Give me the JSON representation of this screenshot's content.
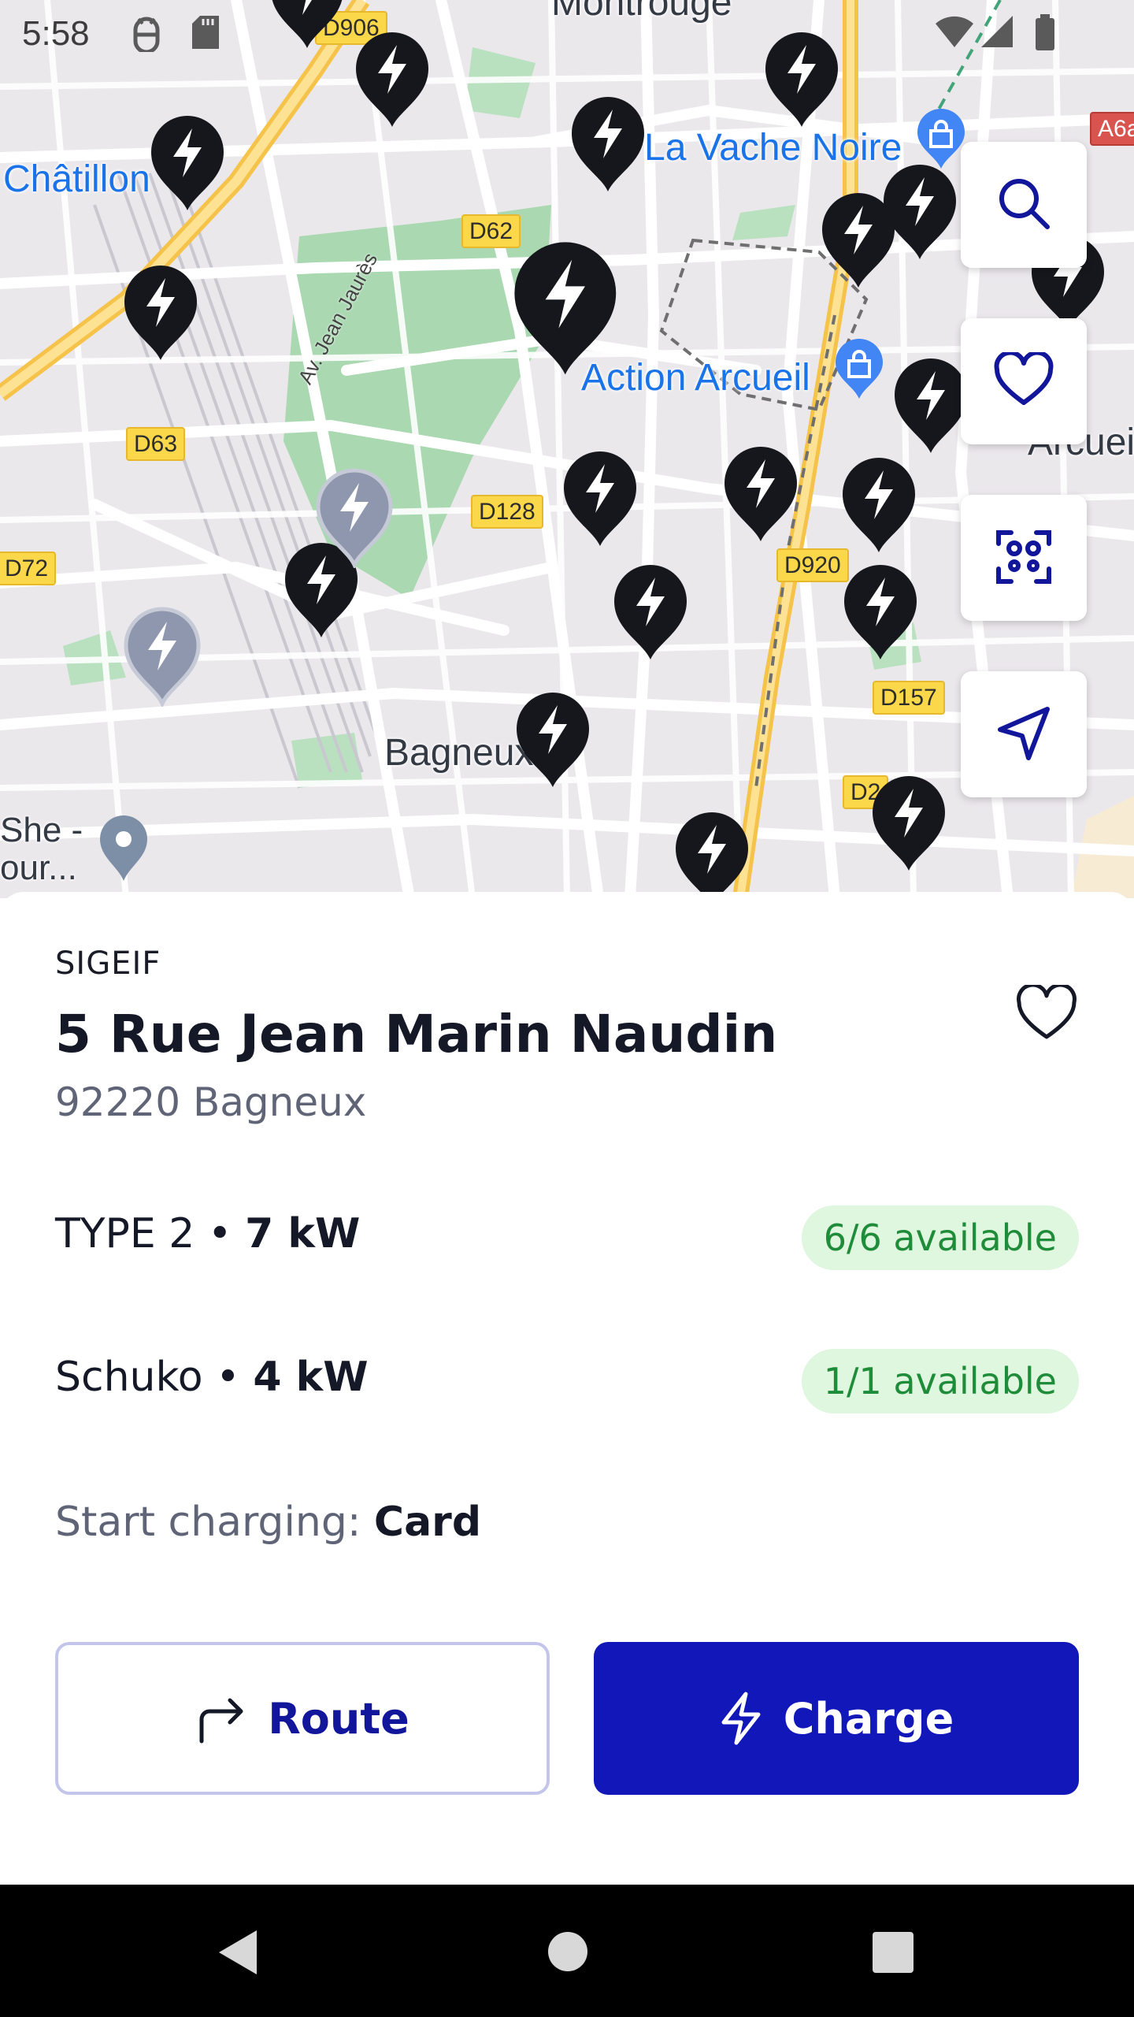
{
  "status_bar": {
    "time": "5:58",
    "icons": [
      "android-debug-icon",
      "sd-card-icon",
      "wifi-icon",
      "signal-icon",
      "battery-icon"
    ]
  },
  "map": {
    "towns": [
      "Montrouge",
      "Châtillon",
      "Bagneux",
      "Arcueil"
    ],
    "pois": [
      "La Vache Noire",
      "Action Arcueil",
      "She - our..."
    ],
    "roads": [
      "D62",
      "D63",
      "D72",
      "D128",
      "D920",
      "D157",
      "D2",
      "A6a",
      "D906"
    ],
    "street": "Av. Jean Jaurès"
  },
  "map_controls": [
    {
      "icon": "search-icon",
      "label": "Search"
    },
    {
      "icon": "heart-icon",
      "label": "Favorites"
    },
    {
      "icon": "scan-qr-icon",
      "label": "Scan"
    },
    {
      "icon": "navigation-icon",
      "label": "My location"
    }
  ],
  "station": {
    "operator": "SIGEIF",
    "address_line1": "5 Rue Jean Marin Naudin",
    "address_line2": "92220 Bagneux",
    "connectors": [
      {
        "type": "TYPE 2",
        "power": "7 kW",
        "availability": "6/6 available"
      },
      {
        "type": "Schuko",
        "power": "4 kW",
        "availability": "1/1 available"
      }
    ],
    "start_charging_label": "Start charging",
    "start_charging_method": "Card"
  },
  "actions": {
    "route_label": "Route",
    "charge_label": "Charge"
  },
  "colors": {
    "primary": "#1117b8",
    "available_bg": "#dff6df",
    "available_text": "#1f8c3a",
    "pin": "#15171c"
  }
}
